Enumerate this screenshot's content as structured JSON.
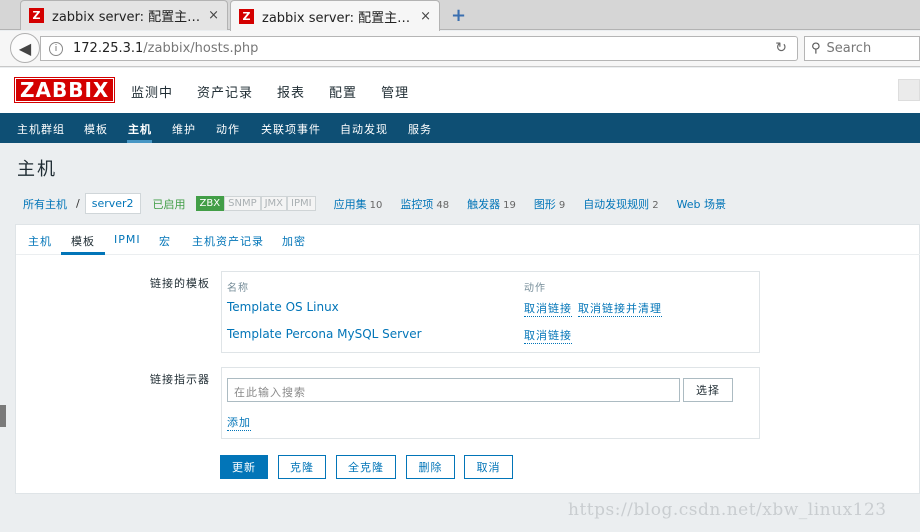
{
  "browser": {
    "tabs": [
      {
        "favicon": "Z",
        "title": "zabbix server: 配置主…",
        "close": "×"
      },
      {
        "favicon": "Z",
        "title": "zabbix server: 配置主…",
        "close": "×"
      }
    ],
    "new_tab_icon": "+",
    "url_host": "172.25.3.1",
    "url_path": "/zabbix/hosts.php",
    "search_placeholder": "Search"
  },
  "header": {
    "logo": "ZABBIX",
    "menu": [
      "监测中",
      "资产记录",
      "报表",
      "配置",
      "管理"
    ]
  },
  "submenu": {
    "items": [
      "主机群组",
      "模板",
      "主机",
      "维护",
      "动作",
      "关联项事件",
      "自动发现",
      "服务"
    ]
  },
  "page": {
    "title": "主机"
  },
  "breadcrumb": {
    "all_hosts": "所有主机",
    "separator": "/",
    "current": "server2",
    "status": "已启用",
    "badges": [
      {
        "label": "ZBX",
        "active": true
      },
      {
        "label": "SNMP",
        "active": false
      },
      {
        "label": "JMX",
        "active": false
      },
      {
        "label": "IPMI",
        "active": false
      }
    ],
    "links": [
      {
        "label": "应用集",
        "count": "10"
      },
      {
        "label": "监控项",
        "count": "48"
      },
      {
        "label": "触发器",
        "count": "19"
      },
      {
        "label": "图形",
        "count": "9"
      },
      {
        "label": "自动发现规则",
        "count": "2"
      },
      {
        "label": "Web 场景",
        "count": ""
      }
    ]
  },
  "form_tabs": [
    "主机",
    "模板",
    "IPMI",
    "宏",
    "主机资产记录",
    "加密"
  ],
  "linked_templates": {
    "label": "链接的模板",
    "col_name": "名称",
    "col_action": "动作",
    "rows": [
      {
        "name": "Template OS Linux",
        "actions": [
          "取消链接",
          "取消链接并清理"
        ]
      },
      {
        "name": "Template Percona MySQL Server",
        "actions": [
          "取消链接"
        ]
      }
    ]
  },
  "link_indicator": {
    "label": "链接指示器",
    "placeholder": "在此输入搜索",
    "select_button": "选择",
    "add_link": "添加"
  },
  "buttons": {
    "update": "更新",
    "clone": "克隆",
    "full_clone": "全克隆",
    "delete": "删除",
    "cancel": "取消"
  },
  "watermark": "https://blog.csdn.net/xbw_linux123"
}
